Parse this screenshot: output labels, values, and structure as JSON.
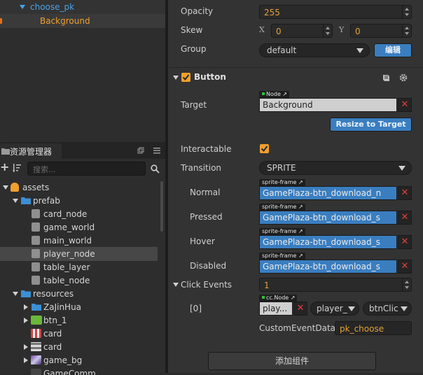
{
  "node_tree": {
    "items": [
      {
        "label": "choose_pk"
      },
      {
        "label": "Background"
      }
    ]
  },
  "asset_panel": {
    "title": "资源管理器",
    "search_placeholder": "搜索...",
    "items": [
      {
        "label": "assets"
      },
      {
        "label": "prefab"
      },
      {
        "label": "card_node"
      },
      {
        "label": "game_world"
      },
      {
        "label": "main_world"
      },
      {
        "label": "player_node"
      },
      {
        "label": "table_layer"
      },
      {
        "label": "table_node"
      },
      {
        "label": "resources"
      },
      {
        "label": "ZaJinHua"
      },
      {
        "label": "btn_1"
      },
      {
        "label": "card"
      },
      {
        "label": "card"
      },
      {
        "label": "game_bg"
      },
      {
        "label": "GameComm"
      }
    ]
  },
  "inspector": {
    "opacity_label": "Opacity",
    "opacity_value": "255",
    "skew_label": "Skew",
    "skew_x_label": "X",
    "skew_x_value": "0",
    "skew_y_label": "Y",
    "skew_y_value": "0",
    "group_label": "Group",
    "group_value": "default",
    "group_edit_button": "编辑",
    "button_component": {
      "title": "Button",
      "target_label": "Target",
      "target_tag": "Node",
      "target_value": "Background",
      "resize_button": "Resize to Target",
      "interactable_label": "Interactable",
      "transition_label": "Transition",
      "transition_value": "SPRITE",
      "sprite_tag": "sprite-frame",
      "normal_label": "Normal",
      "normal_value": "GamePlaza-btn_download_n",
      "pressed_label": "Pressed",
      "pressed_value": "GamePlaza-btn_download_s",
      "hover_label": "Hover",
      "hover_value": "GamePlaza-btn_download_s",
      "disabled_label": "Disabled",
      "disabled_value": "GamePlaza-btn_download_s",
      "click_events_label": "Click Events",
      "click_events_count": "1",
      "event_index": "[0]",
      "event_tag": "cc.Node",
      "event_node": "play...",
      "event_component": "player_",
      "event_handler": "btnClic",
      "custom_data_label": "CustomEventData",
      "custom_data_value": "pk_choose"
    },
    "add_component_button": "添加组件"
  },
  "colors": {
    "accent_orange": "#f0a02e",
    "ref_blue": "#3a7ec0",
    "remove_red": "#e04040"
  }
}
